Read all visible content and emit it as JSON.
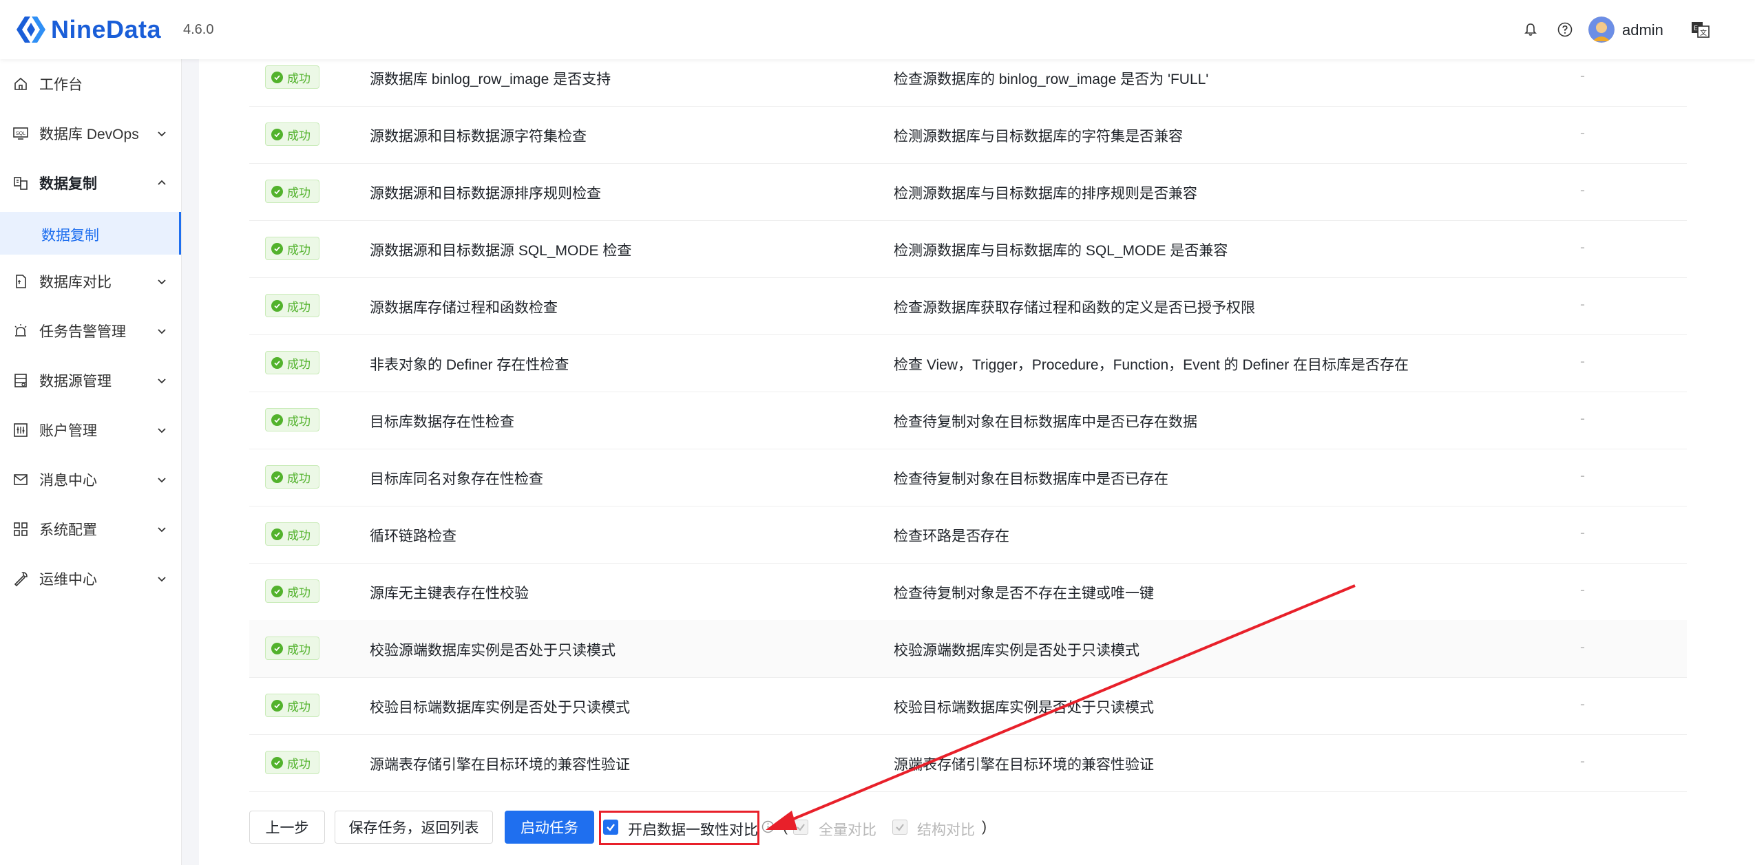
{
  "header": {
    "brand": "NineData",
    "version": "4.6.0",
    "username": "admin"
  },
  "sidebar": {
    "items": [
      {
        "label": "工作台",
        "icon": "home-icon",
        "expandable": false
      },
      {
        "label": "数据库 DevOps",
        "icon": "sql-icon",
        "expandable": true
      },
      {
        "label": "数据复制",
        "icon": "replication-icon",
        "expandable": true,
        "expanded": true
      },
      {
        "label": "数据库对比",
        "icon": "compare-icon",
        "expandable": true
      },
      {
        "label": "任务告警管理",
        "icon": "alarm-icon",
        "expandable": true
      },
      {
        "label": "数据源管理",
        "icon": "datasource-icon",
        "expandable": true
      },
      {
        "label": "账户管理",
        "icon": "account-icon",
        "expandable": true
      },
      {
        "label": "消息中心",
        "icon": "mail-icon",
        "expandable": true
      },
      {
        "label": "系统配置",
        "icon": "grid-icon",
        "expandable": true
      },
      {
        "label": "运维中心",
        "icon": "wrench-icon",
        "expandable": true
      }
    ],
    "active_sub": "数据复制"
  },
  "checks": [
    {
      "status": "成功",
      "name": "源数据库 binlog_row_image 是否支持",
      "desc": "检查源数据库的 binlog_row_image 是否为 'FULL'",
      "result": "-"
    },
    {
      "status": "成功",
      "name": "源数据源和目标数据源字符集检查",
      "desc": "检测源数据库与目标数据库的字符集是否兼容",
      "result": "-"
    },
    {
      "status": "成功",
      "name": "源数据源和目标数据源排序规则检查",
      "desc": "检测源数据库与目标数据库的排序规则是否兼容",
      "result": "-"
    },
    {
      "status": "成功",
      "name": "源数据源和目标数据源 SQL_MODE 检查",
      "desc": "检测源数据库与目标数据库的 SQL_MODE 是否兼容",
      "result": "-"
    },
    {
      "status": "成功",
      "name": "源数据库存储过程和函数检查",
      "desc": "检查源数据库获取存储过程和函数的定义是否已授予权限",
      "result": "-"
    },
    {
      "status": "成功",
      "name": "非表对象的 Definer 存在性检查",
      "desc": "检查 View，Trigger，Procedure，Function，Event 的 Definer 在目标库是否存在",
      "result": "-"
    },
    {
      "status": "成功",
      "name": "目标库数据存在性检查",
      "desc": "检查待复制对象在目标数据库中是否已存在数据",
      "result": "-"
    },
    {
      "status": "成功",
      "name": "目标库同名对象存在性检查",
      "desc": "检查待复制对象在目标数据库中是否已存在",
      "result": "-"
    },
    {
      "status": "成功",
      "name": "循环链路检查",
      "desc": "检查环路是否存在",
      "result": "-"
    },
    {
      "status": "成功",
      "name": "源库无主键表存在性校验",
      "desc": "检查待复制对象是否不存在主键或唯一键",
      "result": "-"
    },
    {
      "status": "成功",
      "name": "校验源端数据库实例是否处于只读模式",
      "desc": "校验源端数据库实例是否处于只读模式",
      "result": "-"
    },
    {
      "status": "成功",
      "name": "校验目标端数据库实例是否处于只读模式",
      "desc": "校验目标端数据库实例是否处于只读模式",
      "result": "-"
    },
    {
      "status": "成功",
      "name": "源端表存储引擎在目标环境的兼容性验证",
      "desc": "源端表存储引擎在目标环境的兼容性验证",
      "result": "-"
    }
  ],
  "footer": {
    "prev_label": "上一步",
    "save_label": "保存任务，返回列表",
    "start_label": "启动任务",
    "consistency_label": "开启数据一致性对比",
    "paren_open": "(",
    "full_compare_label": "全量对比",
    "struct_compare_label": "结构对比",
    "paren_close": ")",
    "consistency_checked": true
  },
  "colors": {
    "primary": "#1f6fef",
    "success": "#52b22c",
    "annotation": "#e8202a"
  }
}
